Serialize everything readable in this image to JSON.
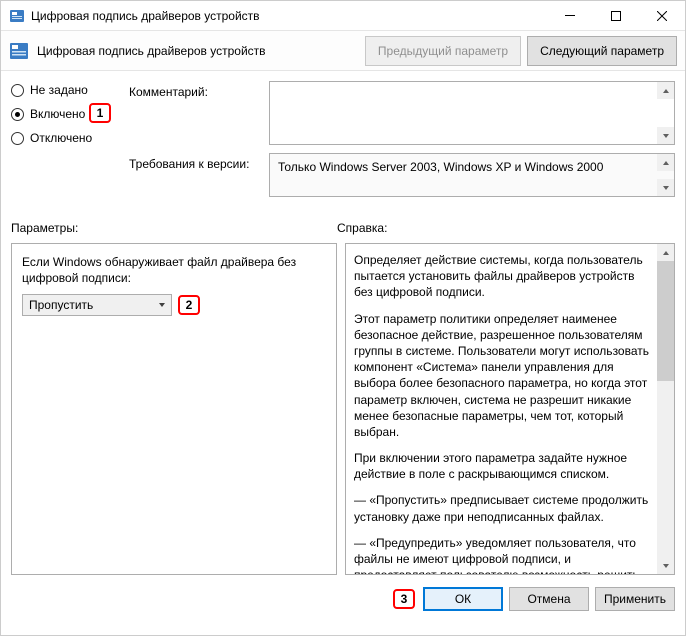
{
  "window": {
    "title": "Цифровая подпись драйверов устройств",
    "header_title": "Цифровая подпись драйверов устройств"
  },
  "nav": {
    "prev": "Предыдущий параметр",
    "next": "Следующий параметр"
  },
  "state": {
    "not_configured": "Не задано",
    "enabled": "Включено",
    "disabled": "Отключено"
  },
  "fields": {
    "comment_label": "Комментарий:",
    "comment_value": "",
    "requirements_label": "Требования к версии:",
    "requirements_value": "Только Windows Server 2003, Windows XP и Windows 2000"
  },
  "sections": {
    "params": "Параметры:",
    "help": "Справка:"
  },
  "params_panel": {
    "label": "Если Windows обнаруживает файл драйвера без цифровой подписи:",
    "selected": "Пропустить"
  },
  "help_panel": {
    "p1": "Определяет действие системы, когда пользователь пытается установить файлы драйверов устройств без цифровой подписи.",
    "p2": "Этот параметр политики определяет наименее безопасное действие, разрешенное пользователям группы в системе. Пользователи могут использовать компонент «Система» панели управления для выбора более безопасного параметра, но когда этот параметр включен, система не разрешит никакие менее безопасные параметры, чем тот, который выбран.",
    "p3": "При включении этого параметра задайте нужное действие в поле с раскрывающимся списком.",
    "p4": "— «Пропустить» предписывает системе продолжить установку даже при неподписанных файлах.",
    "p5": "— «Предупредить» уведомляет пользователя, что файлы не имеют цифровой подписи, и предоставляет пользователю возможность решить, остановить установку или нет."
  },
  "footer": {
    "ok": "ОК",
    "cancel": "Отмена",
    "apply": "Применить"
  },
  "markers": {
    "m1": "1",
    "m2": "2",
    "m3": "3"
  }
}
